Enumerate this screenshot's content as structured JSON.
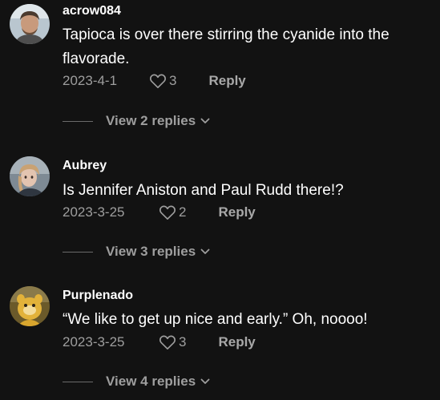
{
  "comments": [
    {
      "username": "acrow084",
      "text": "Tapioca is over there stirring the cyanide into the flavorade.",
      "date": "2023-4-1",
      "likes": "3",
      "reply_label": "Reply",
      "view_replies": "View 2 replies"
    },
    {
      "username": "Aubrey",
      "text": "Is Jennifer Aniston and Paul Rudd there!?",
      "date": "2023-3-25",
      "likes": "2",
      "reply_label": "Reply",
      "view_replies": "View 3 replies"
    },
    {
      "username": "Purplenado",
      "text": "“We like to get up nice and early.” Oh, noooo!",
      "date": "2023-3-25",
      "likes": "3",
      "reply_label": "Reply",
      "view_replies": "View 4 replies"
    }
  ],
  "colors": {
    "background": "#121212",
    "primary_text": "#ffffff",
    "secondary_text": "#9e9e9e"
  }
}
